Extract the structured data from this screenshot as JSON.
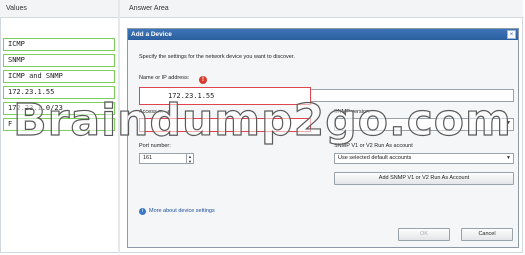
{
  "headers": {
    "values": "Values",
    "answer": "Answer Area"
  },
  "values": [
    "ICMP",
    "SNMP",
    "ICMP and SNMP",
    "172.23.1.55",
    "172.23.1.0/23",
    "F"
  ],
  "dialog": {
    "title": "Add a Device",
    "close": "×",
    "instructions": "Specify the settings for the network device you want to discover.",
    "ip_label": "Name or IP address:",
    "ip_value": "172.23.1.55",
    "access_label": "Access m",
    "access_suffix": "e",
    "snmp_version_label": "SNMP version:",
    "port_label": "Port number:",
    "port_value": "161",
    "runas_label": "SNMP V1 or V2 Run As account",
    "runas_selected": "Use selected default accounts",
    "add_runas_button": "Add SNMP V1 or V2 Run As Account",
    "more_link": "More about device settings",
    "ok": "OK",
    "cancel": "Cancel"
  },
  "watermark": "Braindump2go.com",
  "icons": {
    "warning": "warning-icon",
    "info": "info-icon",
    "close": "close-icon",
    "dropdown": "chevron-down-icon"
  }
}
